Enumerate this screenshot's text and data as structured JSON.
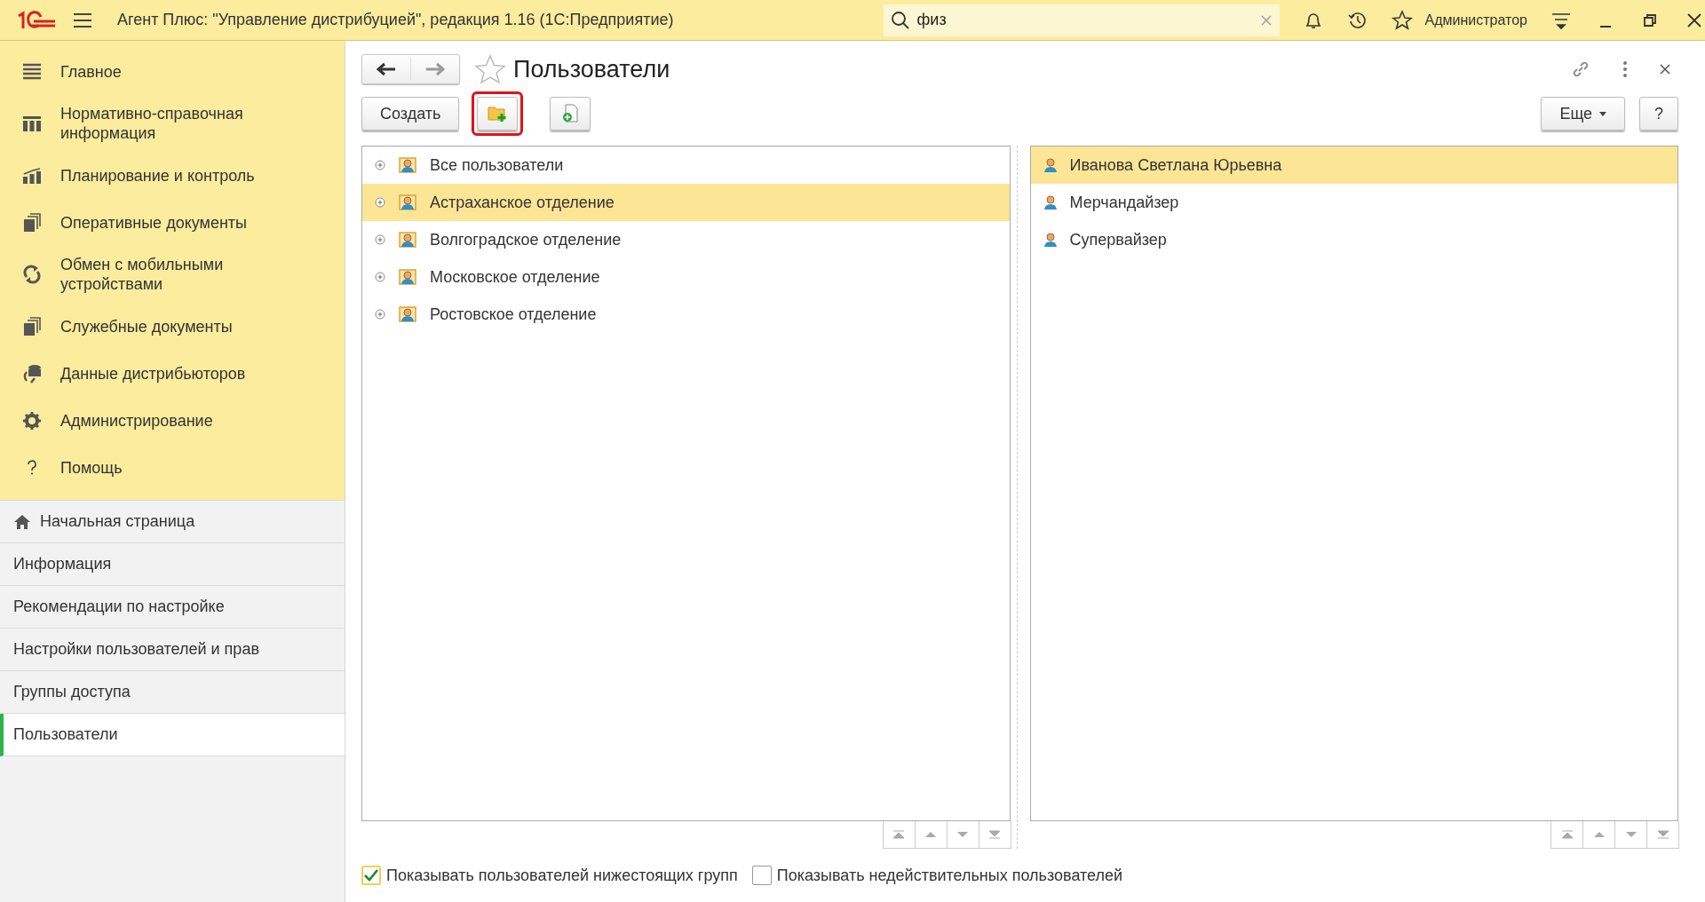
{
  "window": {
    "title": "Агент Плюс: \"Управление дистрибуцией\", редакция 1.16  (1С:Предприятие)",
    "search": {
      "value": "физ"
    },
    "user": "Администратор"
  },
  "sections": [
    {
      "label": "Главное"
    },
    {
      "label": "Нормативно-справочная информация"
    },
    {
      "label": "Планирование и контроль"
    },
    {
      "label": "Оперативные документы"
    },
    {
      "label": "Обмен с мобильными устройствами"
    },
    {
      "label": "Служебные документы"
    },
    {
      "label": "Данные дистрибьюторов"
    },
    {
      "label": "Администрирование"
    },
    {
      "label": "Помощь"
    }
  ],
  "nav_links": [
    {
      "label": "Начальная страница",
      "selected": false
    },
    {
      "label": "Информация",
      "selected": false
    },
    {
      "label": "Рекомендации по настройке",
      "selected": false
    },
    {
      "label": "Настройки пользователей и прав",
      "selected": false
    },
    {
      "label": "Группы доступа",
      "selected": false
    },
    {
      "label": "Пользователи",
      "selected": true
    }
  ],
  "form": {
    "title": "Пользователи",
    "favorite": false,
    "create_label": "Создать",
    "more_label": "Еще",
    "help_label": "?",
    "toolbar_icons": [
      {
        "kind": "folder-add",
        "highlighted": true
      },
      {
        "kind": "doc-add",
        "highlighted": false
      }
    ]
  },
  "groups": [
    {
      "label": "Все пользователи",
      "selected": false
    },
    {
      "label": "Астраханское отделение",
      "selected": true
    },
    {
      "label": "Волгоградское отделение",
      "selected": false
    },
    {
      "label": "Московское отделение",
      "selected": false
    },
    {
      "label": "Ростовское отделение",
      "selected": false
    }
  ],
  "users": [
    {
      "label": "Иванова Светлана Юрьевна",
      "selected": true
    },
    {
      "label": "Мерчандайзер",
      "selected": false
    },
    {
      "label": "Супервайзер",
      "selected": false
    }
  ],
  "options": [
    {
      "label": "Показывать пользователей нижестоящих групп",
      "checked": true
    },
    {
      "label": "Показывать недействительных пользователей",
      "checked": false
    }
  ]
}
